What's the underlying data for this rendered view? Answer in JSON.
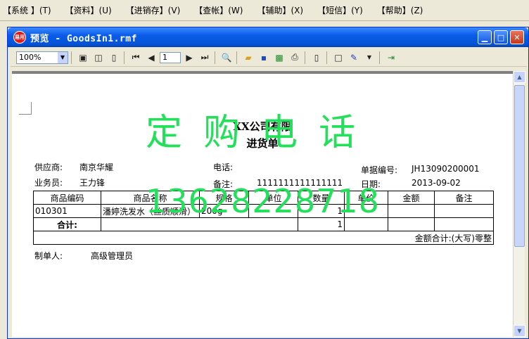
{
  "menu": [
    "【系统 】(T)",
    "【资料】(U)",
    "【进销存】(V)",
    "【查帐】(W)",
    "【辅助】(X)",
    "【短信】(Y)",
    "【帮助】(Z)"
  ],
  "window": {
    "logo": "易用",
    "title": "预览 - GoodsIn1.rmf"
  },
  "toolbar": {
    "zoom": "100%",
    "page": "1"
  },
  "doc": {
    "company": "XX公司有限",
    "title": "进货单",
    "supplier_label": "供应商:",
    "supplier": "南京华耀",
    "phone_label": "电话:",
    "bill_no_label": "单据编号:",
    "bill_no": "JH13090200001",
    "clerk_label": "业务员:",
    "clerk": "王力锋",
    "note_label": "备注:",
    "note": "1111111111111111",
    "date_label": "日期:",
    "date": "2013-09-02",
    "headers": [
      "商品编码",
      "商品名称",
      "规格",
      "单位",
      "数量",
      "单价",
      "金额",
      "备注"
    ],
    "row": {
      "code": "010301",
      "name": "潘婷洗发水（丝质顺滑）",
      "spec": "200g",
      "unit": "",
      "qty": "1",
      "price": "",
      "amount": "",
      "remark": ""
    },
    "total_label": "合计:",
    "total_qty": "1",
    "amount_words": "金额合计:(大写)零整",
    "maker_label": "制单人:",
    "maker": "高级管理员"
  },
  "watermark": {
    "line1": "定购电话",
    "line2": "13628228718",
    "color": "#22e05a"
  }
}
